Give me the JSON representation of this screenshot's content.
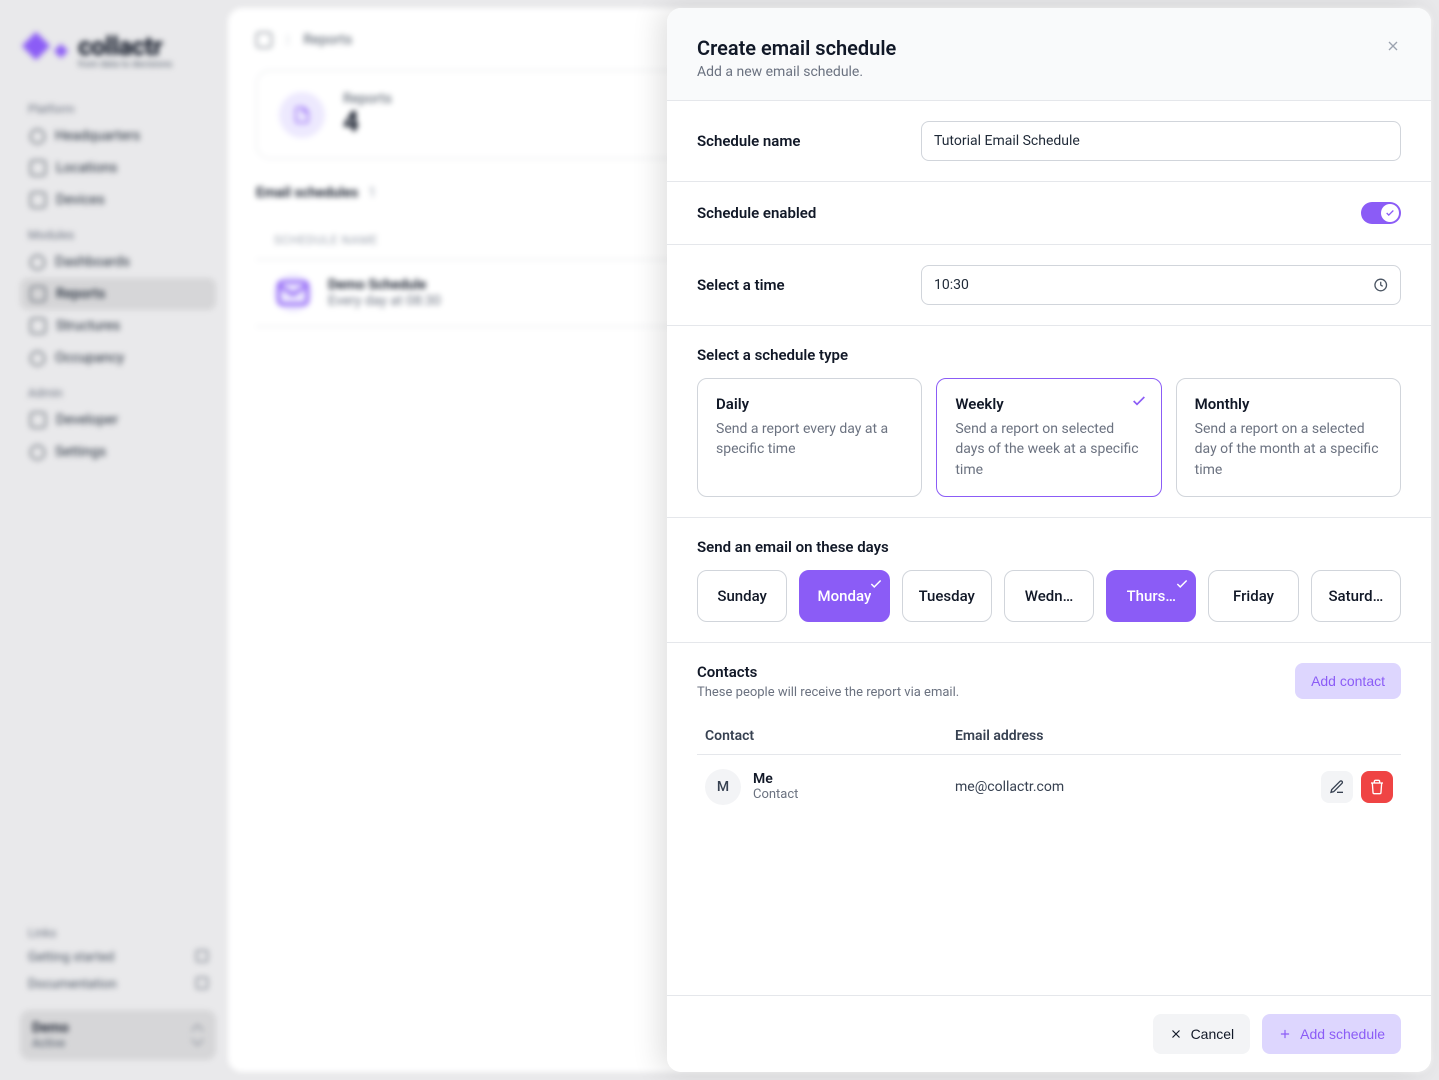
{
  "app": {
    "brand_name": "collactr",
    "brand_tagline": "from data to decisions"
  },
  "sidebar": {
    "labels": {
      "platform": "Platform",
      "modules": "Modules",
      "admin": "Admin",
      "links": "Links"
    },
    "platform": [
      {
        "label": "Headquarters"
      },
      {
        "label": "Locations"
      },
      {
        "label": "Devices"
      }
    ],
    "modules": [
      {
        "label": "Dashboards"
      },
      {
        "label": "Reports",
        "active": true
      },
      {
        "label": "Structures"
      },
      {
        "label": "Occupancy"
      }
    ],
    "admin": [
      {
        "label": "Developer"
      },
      {
        "label": "Settings"
      }
    ],
    "links": [
      {
        "label": "Getting started"
      },
      {
        "label": "Documentation"
      }
    ],
    "org": {
      "name": "Demo",
      "status": "Active"
    }
  },
  "page": {
    "breadcrumb": "Reports",
    "stat_label": "Reports",
    "stat_value": "4",
    "email_schedules_label": "Email schedules",
    "email_schedules_count": "1",
    "schedule_col_header": "SCHEDULE NAME",
    "schedule_row": {
      "name": "Demo Schedule",
      "desc": "Every day at 08:30"
    }
  },
  "modal": {
    "title": "Create email schedule",
    "subtitle": "Add a new email schedule.",
    "fields": {
      "name_label": "Schedule name",
      "name_value": "Tutorial Email Schedule",
      "enabled_label": "Schedule enabled",
      "time_label": "Select a time",
      "time_value": "10:30",
      "type_label": "Select a schedule type",
      "days_label": "Send an email on these days"
    },
    "types": {
      "daily": {
        "title": "Daily",
        "desc": "Send a report every day at a specific time"
      },
      "weekly": {
        "title": "Weekly",
        "desc": "Send a report on selected days of the week at a specific time",
        "selected": true
      },
      "monthly": {
        "title": "Monthly",
        "desc": "Send a report on a selected day of the month at a specific time"
      }
    },
    "days": [
      {
        "label": "Sunday",
        "selected": false
      },
      {
        "label": "Monday",
        "selected": true
      },
      {
        "label": "Tuesday",
        "selected": false
      },
      {
        "label": "Wedn…",
        "selected": false
      },
      {
        "label": "Thurs…",
        "selected": true
      },
      {
        "label": "Friday",
        "selected": false
      },
      {
        "label": "Saturd…",
        "selected": false
      }
    ],
    "contacts": {
      "title": "Contacts",
      "desc": "These people will receive the report via email.",
      "add_label": "Add contact",
      "col_contact": "Contact",
      "col_email": "Email address",
      "rows": [
        {
          "avatar": "M",
          "name": "Me",
          "role": "Contact",
          "email": "me@collactr.com"
        }
      ]
    },
    "footer": {
      "cancel": "Cancel",
      "submit": "Add schedule"
    }
  }
}
